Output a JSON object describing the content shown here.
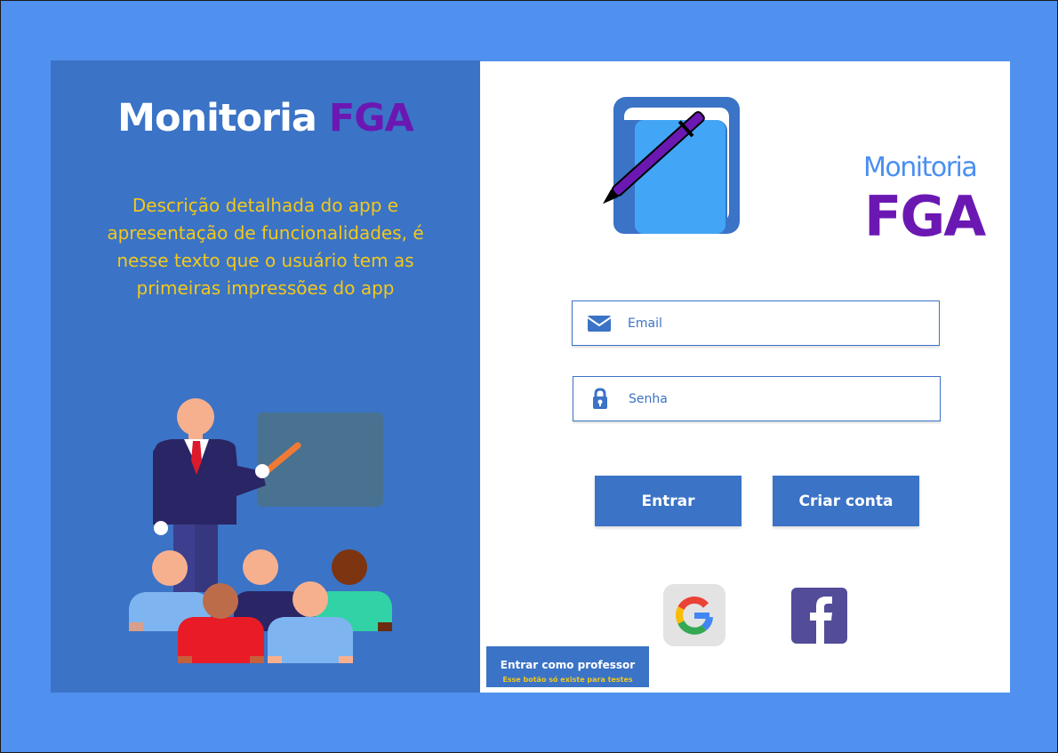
{
  "left_panel": {
    "title_main": "Monitoria",
    "title_accent": "FGA",
    "description": "Descrição detalhada do app e apresentação de funcionalidades, é nesse texto que o usuário tem as primeiras impressões do app",
    "illustration": "teacher-with-students-illustration"
  },
  "logo": {
    "word_top": "Monitoria",
    "word_bottom": "FGA",
    "icon": "book-with-pen-icon"
  },
  "form": {
    "email": {
      "placeholder": "Email",
      "value": "",
      "icon": "envelope-icon"
    },
    "password": {
      "placeholder": "Senha",
      "value": "",
      "icon": "lock-icon"
    },
    "login_label": "Entrar",
    "signup_label": "Criar conta"
  },
  "social": {
    "google": "google-icon",
    "facebook": "facebook-icon"
  },
  "professor_button": {
    "label": "Entrar como professor",
    "note": "Esse botão só existe para testes"
  },
  "colors": {
    "page_bg": "#5090ee",
    "panel_blue": "#3b73c6",
    "accent_purple": "#6b18b3",
    "highlight_yellow": "#f2c81a",
    "logo_light_blue": "#4a8ff0"
  }
}
